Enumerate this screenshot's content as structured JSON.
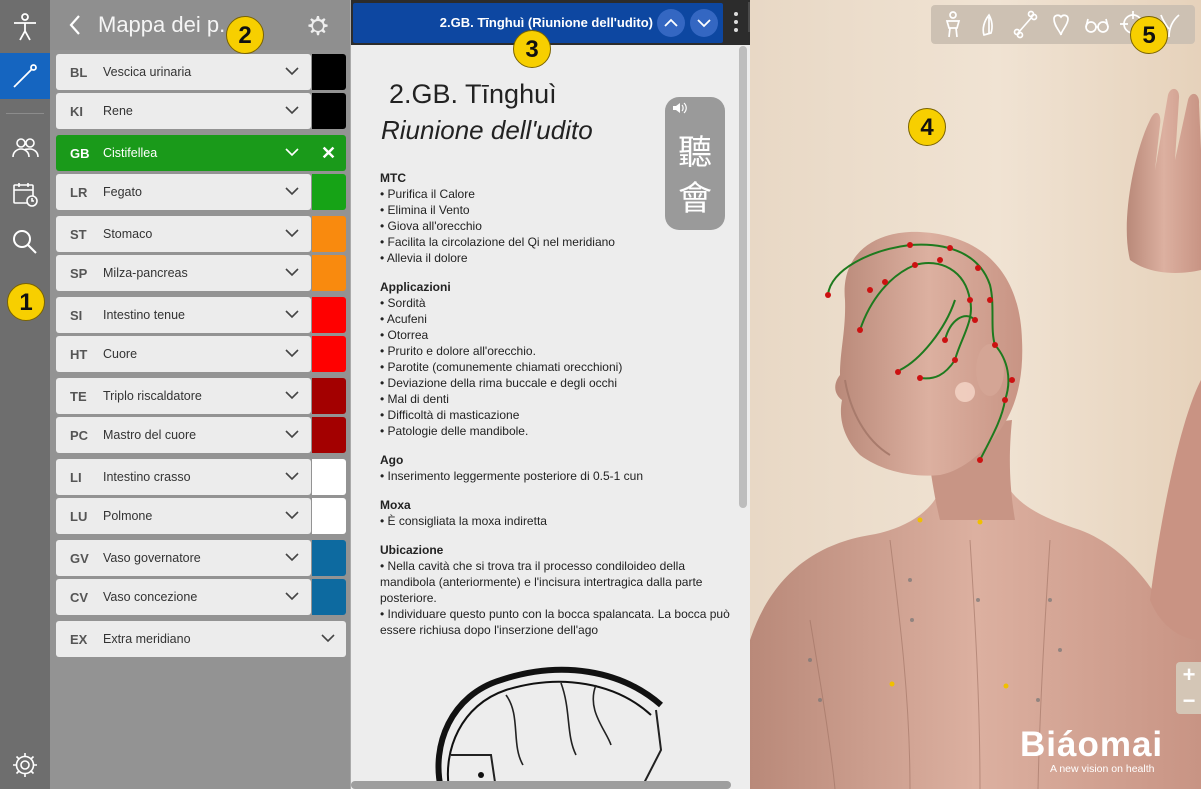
{
  "rail": {
    "items": [
      {
        "icon": "body-icon",
        "active": false
      },
      {
        "icon": "needle-icon",
        "active": true
      },
      {
        "icon": "patients-icon",
        "active": false
      },
      {
        "icon": "calendar-icon",
        "active": false
      },
      {
        "icon": "search-icon",
        "active": false
      },
      {
        "icon": "settings-icon",
        "active": false
      }
    ]
  },
  "meridians": {
    "title": "Mappa dei p...",
    "items": [
      {
        "code": "BL",
        "name": "Vescica urinaria",
        "color": "#000000"
      },
      {
        "code": "KI",
        "name": "Rene",
        "color": "#000000"
      },
      {
        "code": "GB",
        "name": "Cistifellea",
        "color": "#1a9a1a",
        "selected": true
      },
      {
        "code": "LR",
        "name": "Fegato",
        "color": "#16a316"
      },
      {
        "code": "ST",
        "name": "Stomaco",
        "color": "#f98a0e"
      },
      {
        "code": "SP",
        "name": "Milza-pancreas",
        "color": "#f98a0e"
      },
      {
        "code": "SI",
        "name": "Intestino tenue",
        "color": "#ff0000"
      },
      {
        "code": "HT",
        "name": "Cuore",
        "color": "#ff0000"
      },
      {
        "code": "TE",
        "name": "Triplo riscaldatore",
        "color": "#a30000"
      },
      {
        "code": "PC",
        "name": "Mastro del cuore",
        "color": "#a30000"
      },
      {
        "code": "LI",
        "name": "Intestino crasso",
        "color": "#ffffff"
      },
      {
        "code": "LU",
        "name": "Polmone",
        "color": "#ffffff"
      },
      {
        "code": "GV",
        "name": "Vaso governatore",
        "color": "#0d6aa0"
      },
      {
        "code": "CV",
        "name": "Vaso concezione",
        "color": "#0d6aa0"
      },
      {
        "code": "EX",
        "name": "Extra meridiano",
        "color": ""
      }
    ]
  },
  "detail": {
    "header": "2.GB. Tīnghuì (Riunione dell'udito)",
    "point_name": "2.GB. Tīnghuì",
    "point_translation": "Riunione dell'udito",
    "chinese_1": "聽",
    "chinese_2": "會",
    "sections": [
      {
        "title": "MTC",
        "lines": [
          "• Purifica il Calore",
          "• Elimina il Vento",
          "• Giova all'orecchio",
          "• Facilita la circolazione del Qi nel meridiano",
          "• Allevia il dolore"
        ]
      },
      {
        "title": "Applicazioni",
        "lines": [
          "• Sordità",
          "• Acufeni",
          "• Otorrea",
          "• Prurito e dolore all'orecchio.",
          "• Parotite (comunemente chiamati orecchioni)",
          "• Deviazione della rima buccale e degli occhi",
          "• Mal di denti",
          "• Difficoltà di masticazione",
          "• Patologie delle mandibole."
        ]
      },
      {
        "title": "Ago",
        "lines": [
          "• Inserimento leggermente posteriore di 0.5-1 cun"
        ]
      },
      {
        "title": "Moxa",
        "lines": [
          "• È consigliata la moxa indiretta"
        ]
      },
      {
        "title": "Ubicazione",
        "lines": [
          "• Nella cavità che si trova tra il processo condiloideo della mandibola (anteriormente) e l'incisura intertragica dalla parte posteriore.",
          "• Individuare questo punto con la bocca spalancata. La bocca può essere richiusa dopo l'inserzione dell'ago"
        ]
      }
    ]
  },
  "viewer": {
    "tools": [
      "figure-icon",
      "muscle-icon",
      "bone-icon",
      "organs-icon",
      "glasses-icon",
      "target-icon",
      "points-icon"
    ],
    "zoom_in": "+",
    "zoom_out": "−",
    "brand": "Biáomai",
    "tagline": "A new vision on health",
    "meridian_color": "#1e7a1e",
    "point_color": "#cc1111"
  },
  "callouts": [
    "1",
    "2",
    "3",
    "4",
    "5"
  ]
}
